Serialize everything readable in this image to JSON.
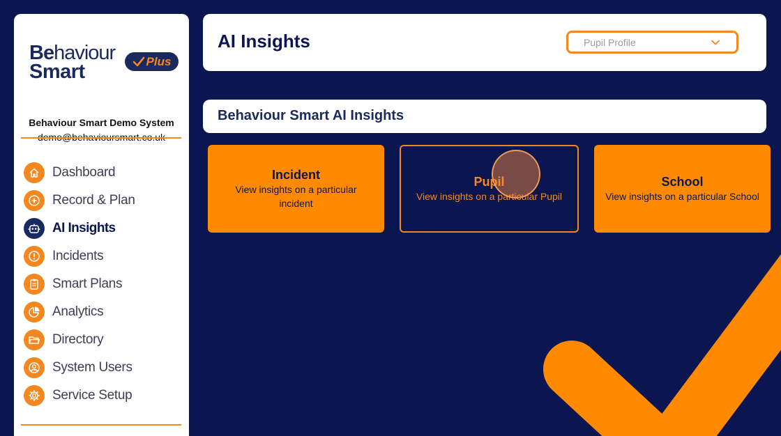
{
  "brand": {
    "logo_line1_bold": "Be",
    "logo_line1_rest": "haviour",
    "logo_line2": "Smart",
    "plus_label": "Plus",
    "org_name": "Behaviour Smart Demo System",
    "org_email": "demo@behavioursmart.co.uk",
    "accent": "#f5871f",
    "navy": "#0b1650"
  },
  "sidebar": {
    "items": [
      {
        "label": "Dashboard",
        "icon": "home-icon"
      },
      {
        "label": "Record & Plan",
        "icon": "plus-circle-icon"
      },
      {
        "label": "AI Insights",
        "icon": "robot-icon",
        "active": true
      },
      {
        "label": "Incidents",
        "icon": "alert-icon"
      },
      {
        "label": "Smart Plans",
        "icon": "clipboard-icon"
      },
      {
        "label": "Analytics",
        "icon": "pie-chart-icon"
      },
      {
        "label": "Directory",
        "icon": "folder-icon"
      },
      {
        "label": "System Users",
        "icon": "user-icon"
      },
      {
        "label": "Service Setup",
        "icon": "gear-icon"
      }
    ]
  },
  "header": {
    "title": "AI Insights",
    "select_value": "Pupil Profile"
  },
  "section": {
    "title": "Behaviour Smart AI Insights"
  },
  "cards": [
    {
      "title": "Incident",
      "description": "View insights on a particular incident"
    },
    {
      "title": "Pupil",
      "description": "View insights on a particular Pupil"
    },
    {
      "title": "School",
      "description": "View insights on a particular School"
    }
  ]
}
